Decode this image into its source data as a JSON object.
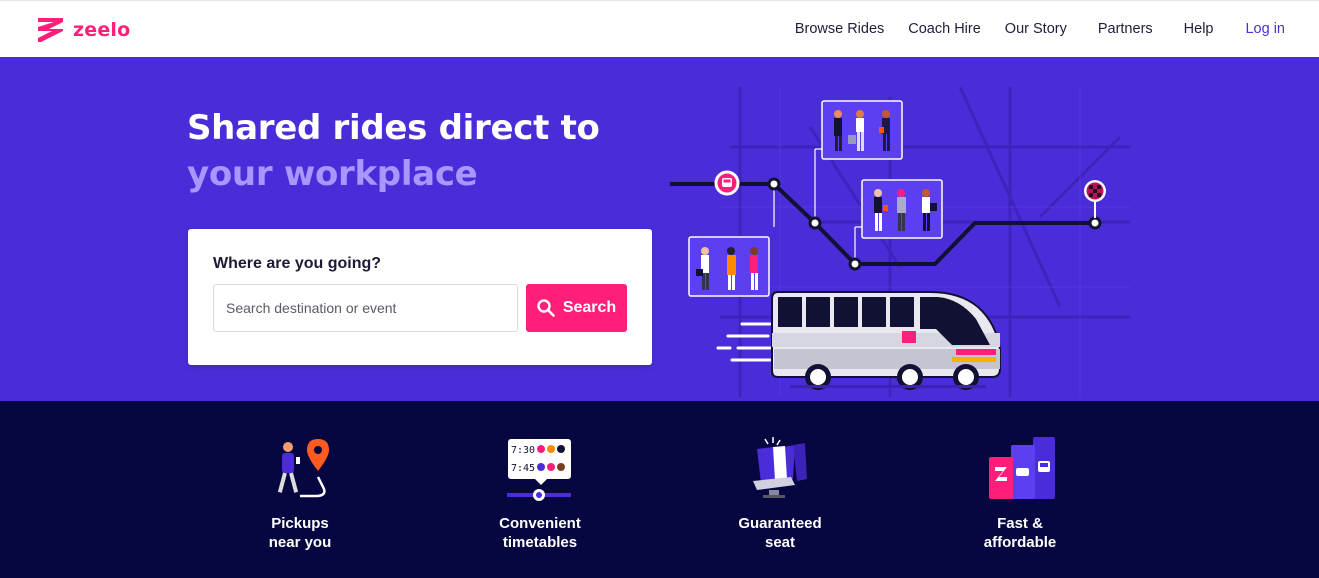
{
  "brand": {
    "name": "zeelo",
    "color": "#ff1f7b",
    "icon": "zeelo-logo-icon"
  },
  "nav": {
    "items": [
      "Browse Rides",
      "Coach Hire",
      "Our Story",
      "Partners",
      "Help"
    ],
    "login": "Log in"
  },
  "hero": {
    "title_line1": "Shared rides direct to",
    "title_line2": "your workplace",
    "background": "#4a2dd9",
    "search": {
      "label": "Where are you going?",
      "placeholder": "Search destination or event",
      "value": "",
      "button": "Search",
      "button_icon": "search-icon"
    },
    "illustration": {
      "schedule_times": [],
      "icons": [
        "bus-stop-icon",
        "finish-flag-icon",
        "coach-bus-icon"
      ]
    }
  },
  "features": {
    "background": "#060640",
    "items": [
      {
        "label": "Pickups\nnear you",
        "icon": "pickup-location-icon"
      },
      {
        "label": "Convenient\ntimetables",
        "icon": "timetable-icon",
        "times": [
          "7:30",
          "7:45"
        ]
      },
      {
        "label": "Guaranteed\nseat",
        "icon": "seat-icon"
      },
      {
        "label": "Fast &\naffordable",
        "icon": "affordable-icon"
      }
    ]
  }
}
